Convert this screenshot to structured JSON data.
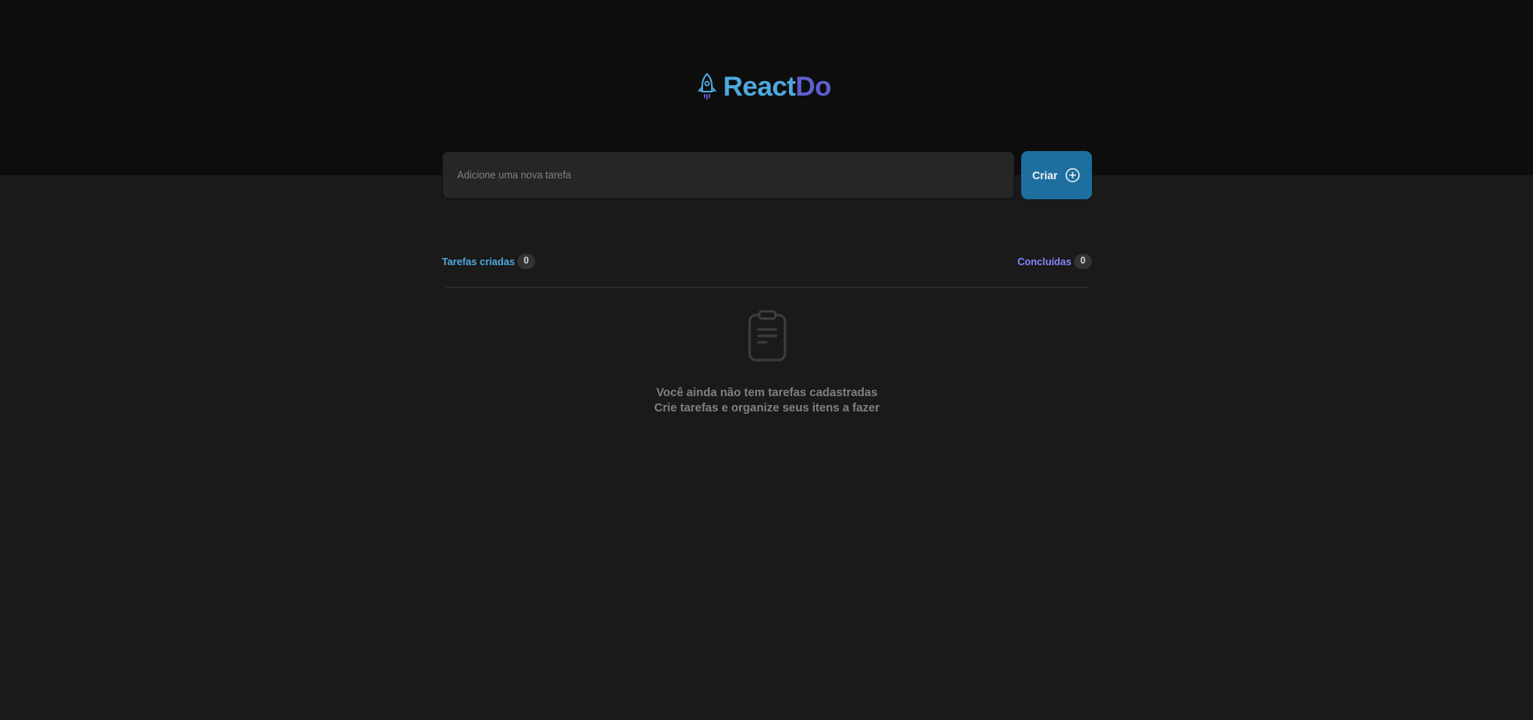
{
  "app": {
    "logo_part1": "React",
    "logo_part2": "Do",
    "logo_icon": "rocket-icon"
  },
  "new_task": {
    "placeholder": "Adicione uma nova tarefa",
    "value": "",
    "create_label": "Criar",
    "create_icon": "plus-circle-icon"
  },
  "counters": {
    "created_label": "Tarefas criadas",
    "created_count": "0",
    "done_label": "Concluídas",
    "done_count": "0"
  },
  "empty_state": {
    "icon": "clipboard-icon",
    "title": "Você ainda não tem tarefas cadastradas",
    "subtitle": "Crie tarefas e organize seus itens a fazer"
  },
  "colors": {
    "header_bg": "#0d0d0d",
    "page_bg": "#1a1a1a",
    "blue": "#4ea8de",
    "purple": "#5e60ce",
    "button": "#1e6f9f"
  }
}
